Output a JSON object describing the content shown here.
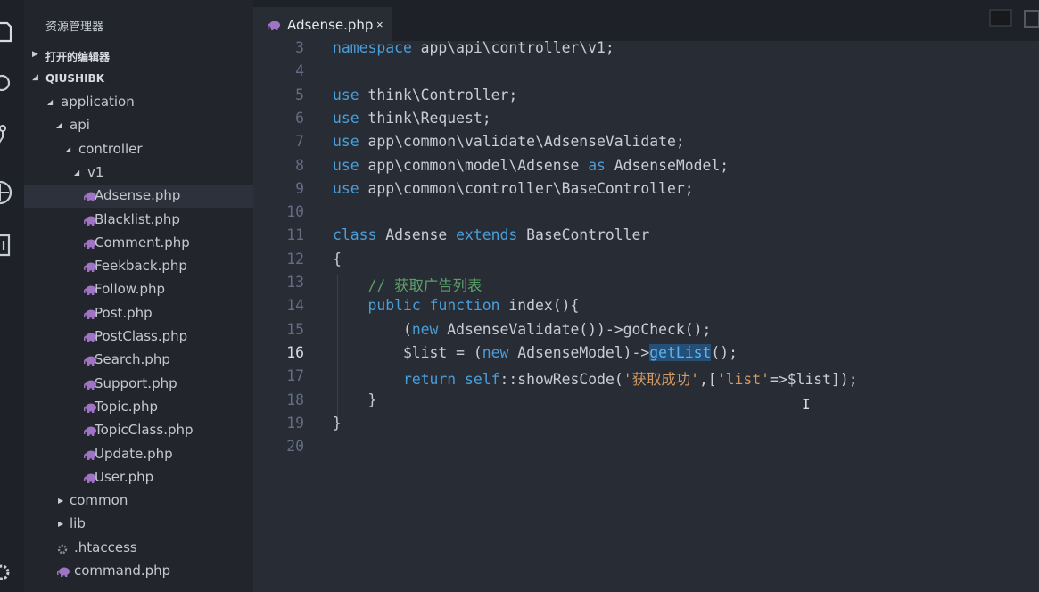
{
  "sidebar": {
    "title": "资源管理器",
    "open_editors": "打开的编辑器",
    "project": "QIUSHIBK",
    "tree": [
      {
        "label": "application",
        "type": "folder"
      },
      {
        "label": "api",
        "type": "folder"
      },
      {
        "label": "controller",
        "type": "folder"
      },
      {
        "label": "v1",
        "type": "folder"
      },
      {
        "label": "Adsense.php",
        "type": "php"
      },
      {
        "label": "Blacklist.php",
        "type": "php"
      },
      {
        "label": "Comment.php",
        "type": "php"
      },
      {
        "label": "Feekback.php",
        "type": "php"
      },
      {
        "label": "Follow.php",
        "type": "php"
      },
      {
        "label": "Post.php",
        "type": "php"
      },
      {
        "label": "PostClass.php",
        "type": "php"
      },
      {
        "label": "Search.php",
        "type": "php"
      },
      {
        "label": "Support.php",
        "type": "php"
      },
      {
        "label": "Topic.php",
        "type": "php"
      },
      {
        "label": "TopicClass.php",
        "type": "php"
      },
      {
        "label": "Update.php",
        "type": "php"
      },
      {
        "label": "User.php",
        "type": "php"
      },
      {
        "label": "common",
        "type": "folder"
      },
      {
        "label": "lib",
        "type": "folder"
      },
      {
        "label": ".htaccess",
        "type": "config"
      },
      {
        "label": "command.php",
        "type": "php"
      }
    ]
  },
  "tab": {
    "name": "Adsense.php",
    "close": "×"
  },
  "editor": {
    "current_line": "16",
    "lines": [
      {
        "n": "3",
        "tokens": [
          {
            "t": "namespace",
            "c": "kw"
          },
          {
            "t": " app\\api\\controller\\v1;"
          }
        ]
      },
      {
        "n": "4",
        "tokens": []
      },
      {
        "n": "5",
        "tokens": [
          {
            "t": "use",
            "c": "kw"
          },
          {
            "t": " think\\Controller;"
          }
        ]
      },
      {
        "n": "6",
        "tokens": [
          {
            "t": "use",
            "c": "kw"
          },
          {
            "t": " think\\Request;"
          }
        ]
      },
      {
        "n": "7",
        "tokens": [
          {
            "t": "use",
            "c": "kw"
          },
          {
            "t": " app\\common\\validate\\AdsenseValidate;"
          }
        ]
      },
      {
        "n": "8",
        "tokens": [
          {
            "t": "use",
            "c": "kw"
          },
          {
            "t": " app\\common\\model\\Adsense "
          },
          {
            "t": "as",
            "c": "kw"
          },
          {
            "t": " AdsenseModel;"
          }
        ]
      },
      {
        "n": "9",
        "tokens": [
          {
            "t": "use",
            "c": "kw"
          },
          {
            "t": " app\\common\\controller\\BaseController;"
          }
        ]
      },
      {
        "n": "10",
        "tokens": []
      },
      {
        "n": "11",
        "tokens": [
          {
            "t": "class",
            "c": "kw"
          },
          {
            "t": " Adsense "
          },
          {
            "t": "extends",
            "c": "kw"
          },
          {
            "t": " BaseController"
          }
        ]
      },
      {
        "n": "12",
        "tokens": [
          {
            "t": "{"
          }
        ]
      },
      {
        "n": "13",
        "tokens": [
          {
            "t": "    "
          },
          {
            "t": "// 获取广告列表",
            "c": "cm"
          }
        ]
      },
      {
        "n": "14",
        "tokens": [
          {
            "t": "    "
          },
          {
            "t": "public",
            "c": "kw"
          },
          {
            "t": " "
          },
          {
            "t": "function",
            "c": "kw"
          },
          {
            "t": " index(){"
          }
        ]
      },
      {
        "n": "15",
        "tokens": [
          {
            "t": "        ("
          },
          {
            "t": "new",
            "c": "kw"
          },
          {
            "t": " AdsenseValidate())->goCheck();"
          }
        ]
      },
      {
        "n": "16",
        "tokens": [
          {
            "t": "        $list = ("
          },
          {
            "t": "new",
            "c": "kw"
          },
          {
            "t": " AdsenseModel)->"
          },
          {
            "t": "getList",
            "c": "hl"
          },
          {
            "t": "();"
          }
        ]
      },
      {
        "n": "17",
        "tokens": [
          {
            "t": "        "
          },
          {
            "t": "return",
            "c": "kw"
          },
          {
            "t": " "
          },
          {
            "t": "self",
            "c": "kw"
          },
          {
            "t": "::showResCode("
          },
          {
            "t": "'获取成功'",
            "c": "st"
          },
          {
            "t": ",["
          },
          {
            "t": "'list'",
            "c": "st"
          },
          {
            "t": "=>$list]);"
          }
        ]
      },
      {
        "n": "18",
        "tokens": [
          {
            "t": "    }"
          }
        ]
      },
      {
        "n": "19",
        "tokens": [
          {
            "t": "}"
          }
        ]
      },
      {
        "n": "20",
        "tokens": []
      }
    ]
  },
  "colors": {
    "keyword": "#4a9eda",
    "comment": "#5c9f6b",
    "string": "#d19a66",
    "selection": "#264f78",
    "php_icon": "#a074c4"
  },
  "icons": [
    "files-icon",
    "search-icon",
    "source-control-icon",
    "debug-icon",
    "extensions-icon",
    "settings-icon",
    "php-elephant-icon",
    "gear-file-icon"
  ]
}
